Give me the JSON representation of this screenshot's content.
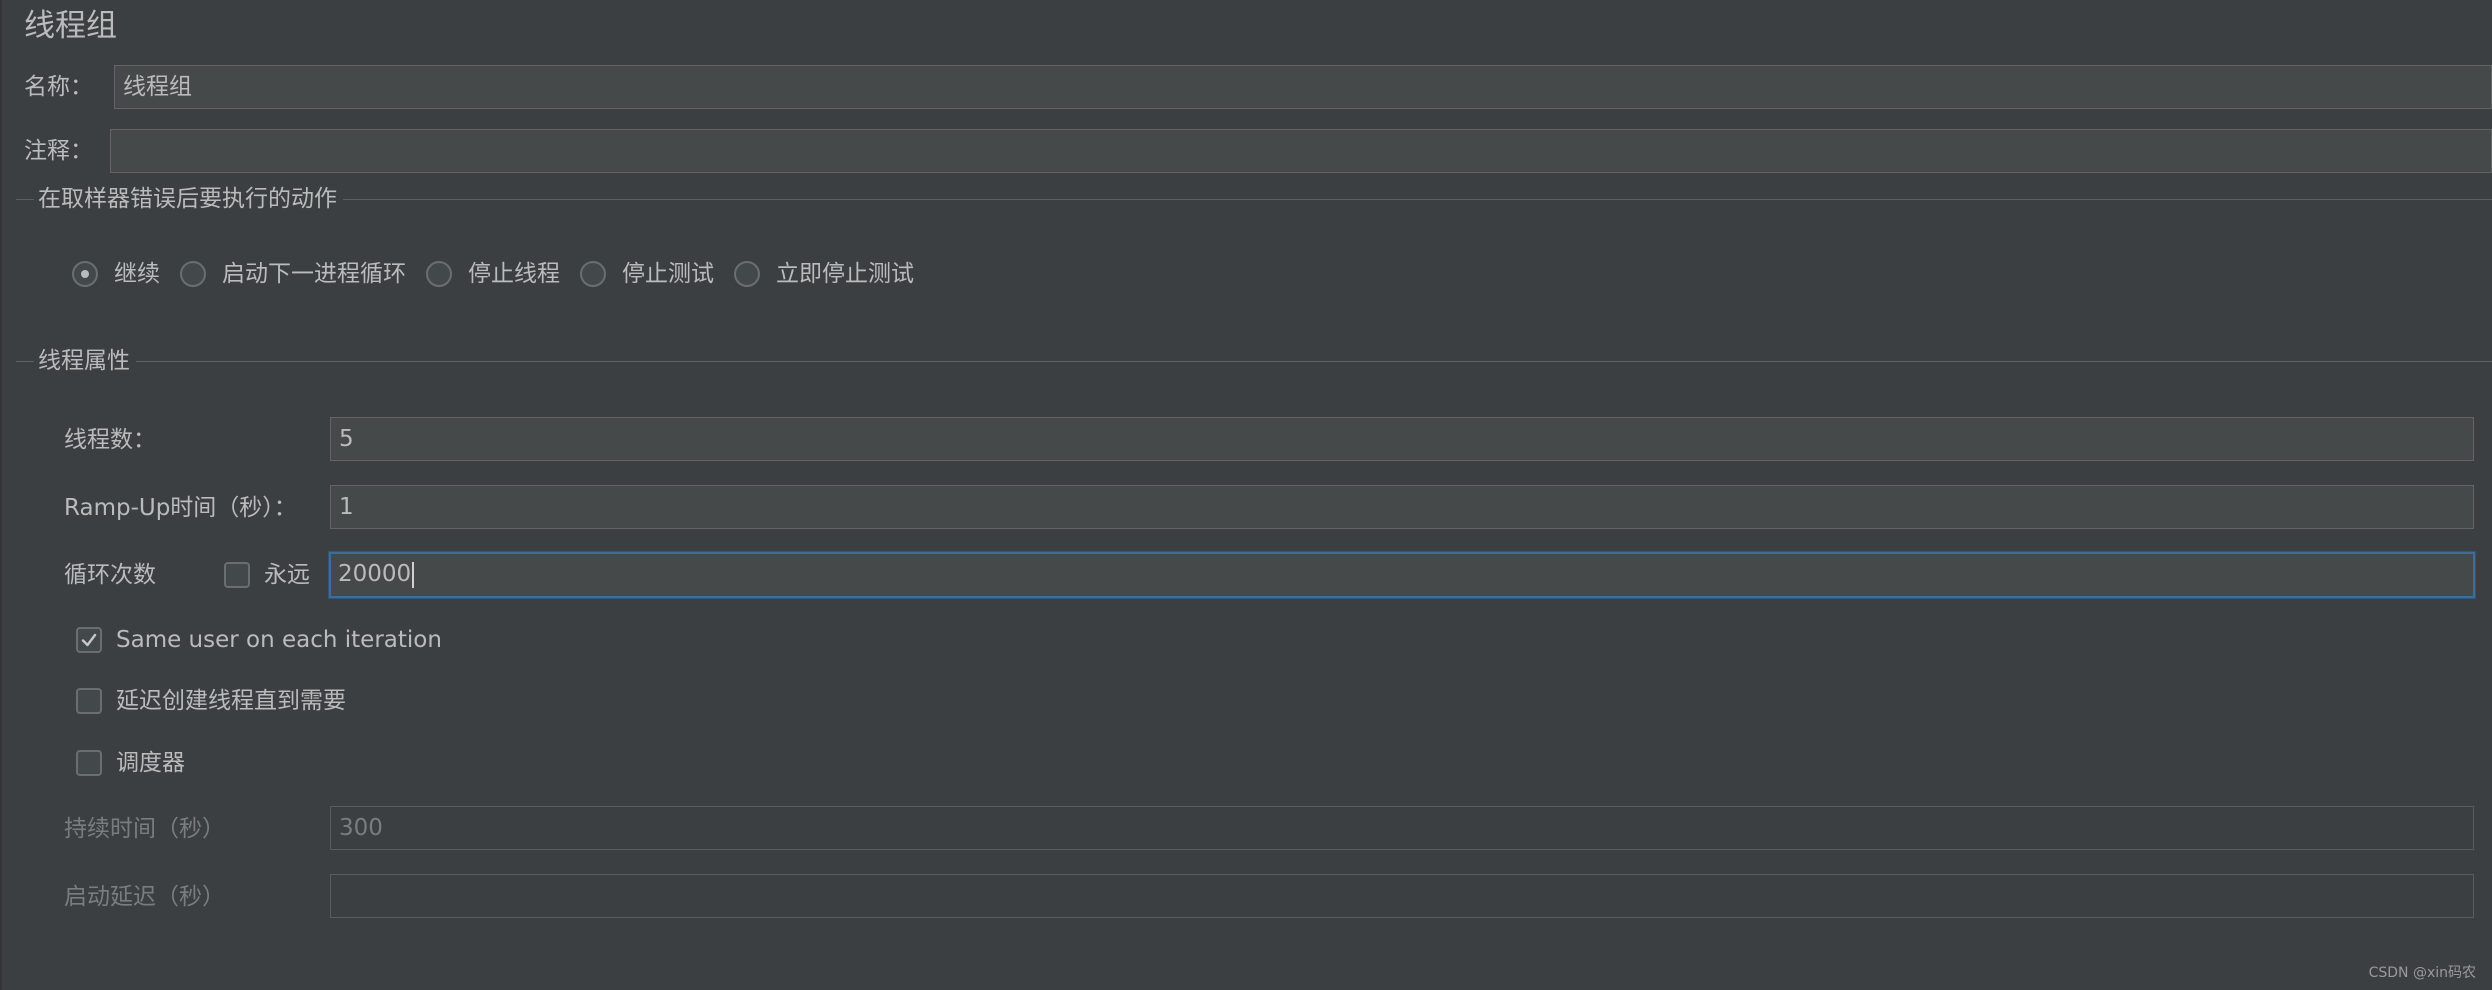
{
  "panel": {
    "title": "线程组",
    "name_label": "名称：",
    "name_value": "线程组",
    "comment_label": "注释：",
    "comment_value": ""
  },
  "error_action": {
    "section_title": "在取样器错误后要执行的动作",
    "options": [
      {
        "label": "继续",
        "selected": true
      },
      {
        "label": "启动下一进程循环",
        "selected": false
      },
      {
        "label": "停止线程",
        "selected": false
      },
      {
        "label": "停止测试",
        "selected": false
      },
      {
        "label": "立即停止测试",
        "selected": false
      }
    ]
  },
  "thread_props": {
    "section_title": "线程属性",
    "threads_label": "线程数：",
    "threads_value": "5",
    "rampup_label": "Ramp-Up时间（秒）：",
    "rampup_value": "1",
    "loop_label": "循环次数",
    "forever_label": "永远",
    "forever_checked": false,
    "loop_value": "20000",
    "same_user_label": "Same user on each iteration",
    "same_user_checked": true,
    "delay_create_label": "延迟创建线程直到需要",
    "delay_create_checked": false,
    "scheduler_label": "调度器",
    "scheduler_checked": false,
    "duration_label": "持续时间（秒）",
    "duration_value": "300",
    "startup_delay_label": "启动延迟（秒）",
    "startup_delay_value": ""
  },
  "watermark": "CSDN @xin码农",
  "colors": {
    "background": "#3c3f41",
    "field": "#45494a",
    "text": "#bbbbbb",
    "focus": "#3e6d9c"
  }
}
